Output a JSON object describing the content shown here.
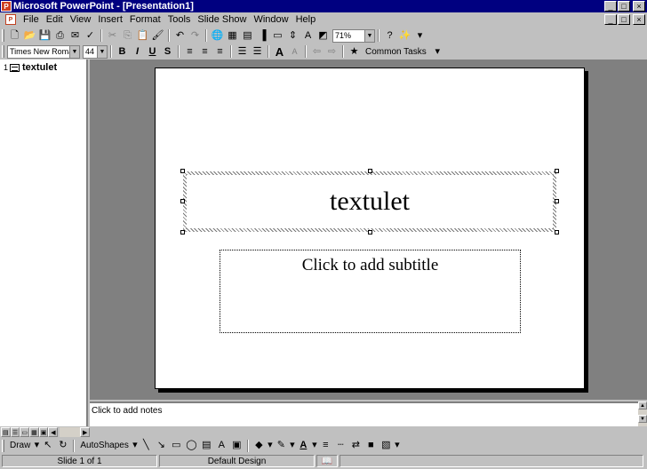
{
  "window": {
    "title": "Microsoft PowerPoint - [Presentation1]",
    "buttons": {
      "minimize": "_",
      "maximize": "□",
      "close": "×"
    }
  },
  "menu": [
    "File",
    "Edit",
    "View",
    "Insert",
    "Format",
    "Tools",
    "Slide Show",
    "Window",
    "Help"
  ],
  "standard_toolbar": {
    "zoom": "71%"
  },
  "formatting_toolbar": {
    "font_name": "Times New Roman",
    "font_size": "44",
    "common_tasks": "Common Tasks"
  },
  "outline": {
    "slide_number": "1",
    "slide_title": "textulet"
  },
  "slide": {
    "title_text": "textulet",
    "subtitle_placeholder": "Click to add subtitle"
  },
  "notes": {
    "placeholder": "Click to add notes"
  },
  "drawing_toolbar": {
    "draw": "Draw",
    "autoshapes": "AutoShapes"
  },
  "status": {
    "slide_position": "Slide 1 of 1",
    "design": "Default Design"
  },
  "colors": {
    "titlebar": "#000080",
    "face": "#c0c0c0",
    "workspace": "#808080"
  }
}
